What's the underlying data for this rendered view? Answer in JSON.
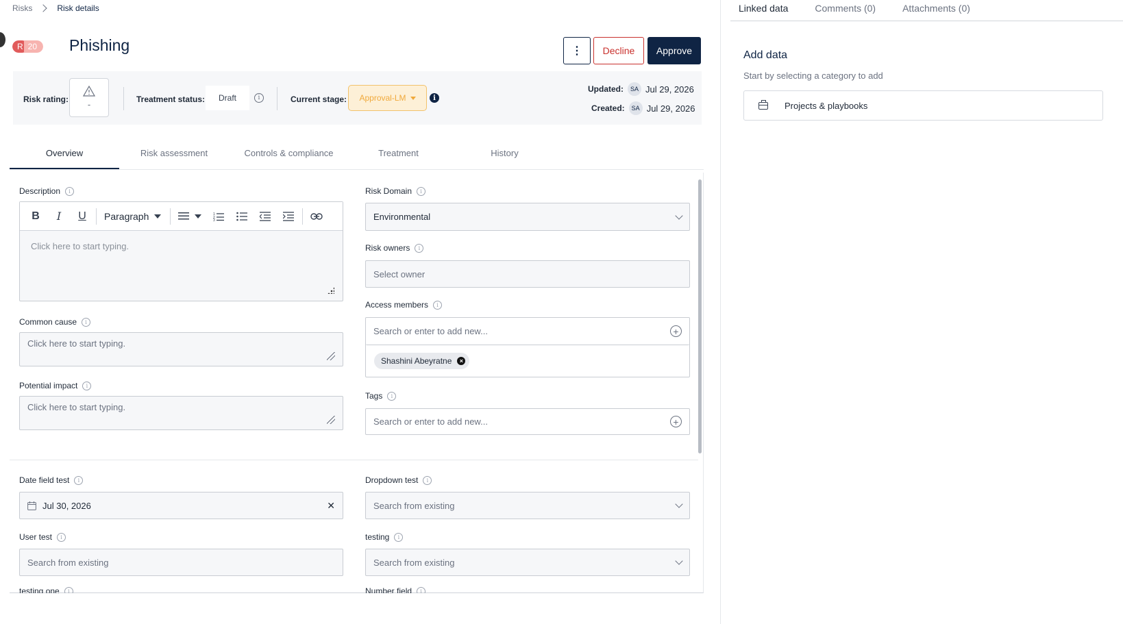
{
  "breadcrumb": {
    "root": "Risks",
    "current": "Risk details"
  },
  "risk": {
    "badge_letter": "R",
    "badge_score": "20",
    "title": "Phishing"
  },
  "actions": {
    "more": "⋮",
    "decline": "Decline",
    "approve": "Approve"
  },
  "info": {
    "rating_label": "Risk rating:",
    "rating_value": "-",
    "treatment_label": "Treatment status:",
    "treatment_value": "Draft",
    "stage_label": "Current stage:",
    "stage_value": "Approval-LM",
    "updated_label": "Updated:",
    "updated_initials": "SA",
    "updated_date": "Jul 29, 2026",
    "created_label": "Created:",
    "created_initials": "SA",
    "created_date": "Jul 29, 2026"
  },
  "tabs": [
    "Overview",
    "Risk assessment",
    "Controls & compliance",
    "Treatment",
    "History"
  ],
  "form": {
    "description_label": "Description",
    "rte_paragraph": "Paragraph",
    "rte_placeholder": "Click here to start typing.",
    "common_cause_label": "Common cause",
    "common_cause_placeholder": "Click here to start typing.",
    "potential_impact_label": "Potential impact",
    "potential_impact_placeholder": "Click here to start typing.",
    "risk_domain_label": "Risk Domain",
    "risk_domain_value": "Environmental",
    "risk_owners_label": "Risk owners",
    "risk_owners_placeholder": "Select owner",
    "access_members_label": "Access members",
    "access_members_placeholder": "Search or enter to add new...",
    "access_member_chip": "Shashini Abeyratne",
    "tags_label": "Tags",
    "tags_placeholder": "Search or enter to add new...",
    "date_field_label": "Date field test",
    "date_field_value": "Jul 30, 2026",
    "dropdown_test_label": "Dropdown test",
    "dropdown_test_placeholder": "Search from existing",
    "user_test_label": "User test",
    "user_test_placeholder": "Search from existing",
    "testing_label": "testing",
    "testing_placeholder": "Search from existing",
    "testing_one_label": "testing one",
    "number_field_label": "Number field"
  },
  "right_panel": {
    "tabs": [
      "Linked data",
      "Comments (0)",
      "Attachments (0)"
    ],
    "add_title": "Add data",
    "add_subtitle": "Start by selecting a category to add",
    "category": "Projects & playbooks"
  },
  "colors": {
    "brand": "#0f2444",
    "decline": "#c9302c",
    "stage": "#f0a93b",
    "badge": "#e15b5b"
  }
}
